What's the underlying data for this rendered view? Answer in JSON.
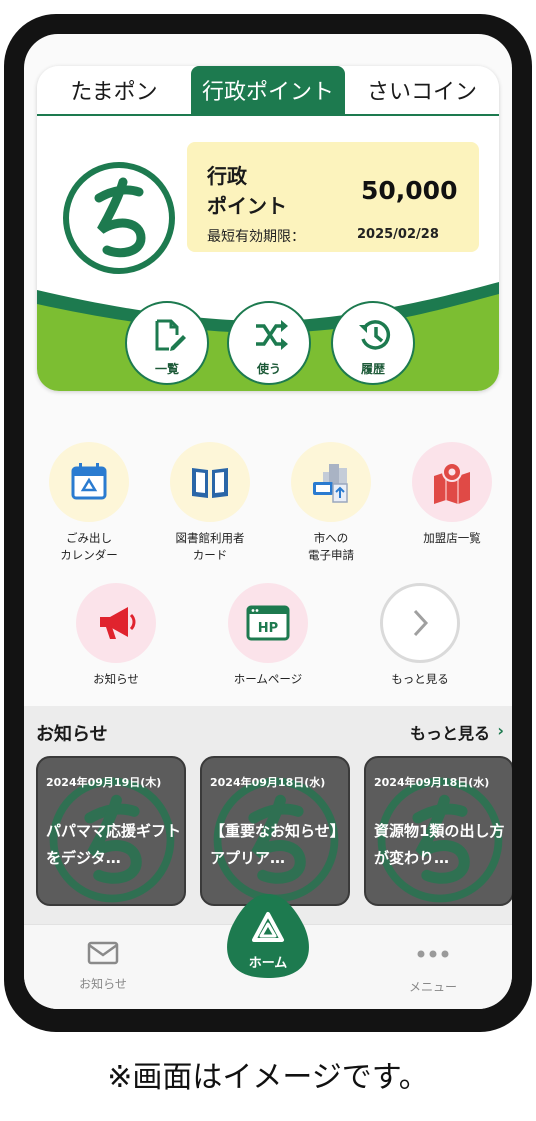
{
  "tabs": [
    "たまポン",
    "行政ポイント",
    "さいコイン"
  ],
  "point_card": {
    "label_line1": "行政",
    "label_line2": "ポイント",
    "value": "50,000",
    "expiry_label": "最短有効期限：",
    "expiry_value": "2025/02/28"
  },
  "card_actions": [
    "一覧",
    "使う",
    "履歴"
  ],
  "menu": {
    "garbage": "ごみ出し\nカレンダー",
    "library": "図書館利用者\nカード",
    "e_application": "市への\n電子申請",
    "stores": "加盟店一覧",
    "notices": "お知らせ",
    "homepage": "ホームページ",
    "homepage_icon_text": "HP",
    "more": "もっと見る"
  },
  "news": {
    "title": "お知らせ",
    "more_label": "もっと見る",
    "items": [
      {
        "date": "2024年09月19日(木)",
        "text": "パパママ応援ギフトをデジタ…"
      },
      {
        "date": "2024年09月18日(水)",
        "text": "【重要なお知らせ】アプリア…"
      },
      {
        "date": "2024年09月18日(水)",
        "text": "資源物1類の出し方が変わり…"
      }
    ]
  },
  "bottom_nav": {
    "notices": "お知らせ",
    "home": "ホーム",
    "menu": "メニュー"
  },
  "caption": "※画面はイメージです。",
  "colors": {
    "brand_green": "#1d7a4f",
    "light_green": "#7cbe32",
    "point_box": "#fcf3bd"
  }
}
